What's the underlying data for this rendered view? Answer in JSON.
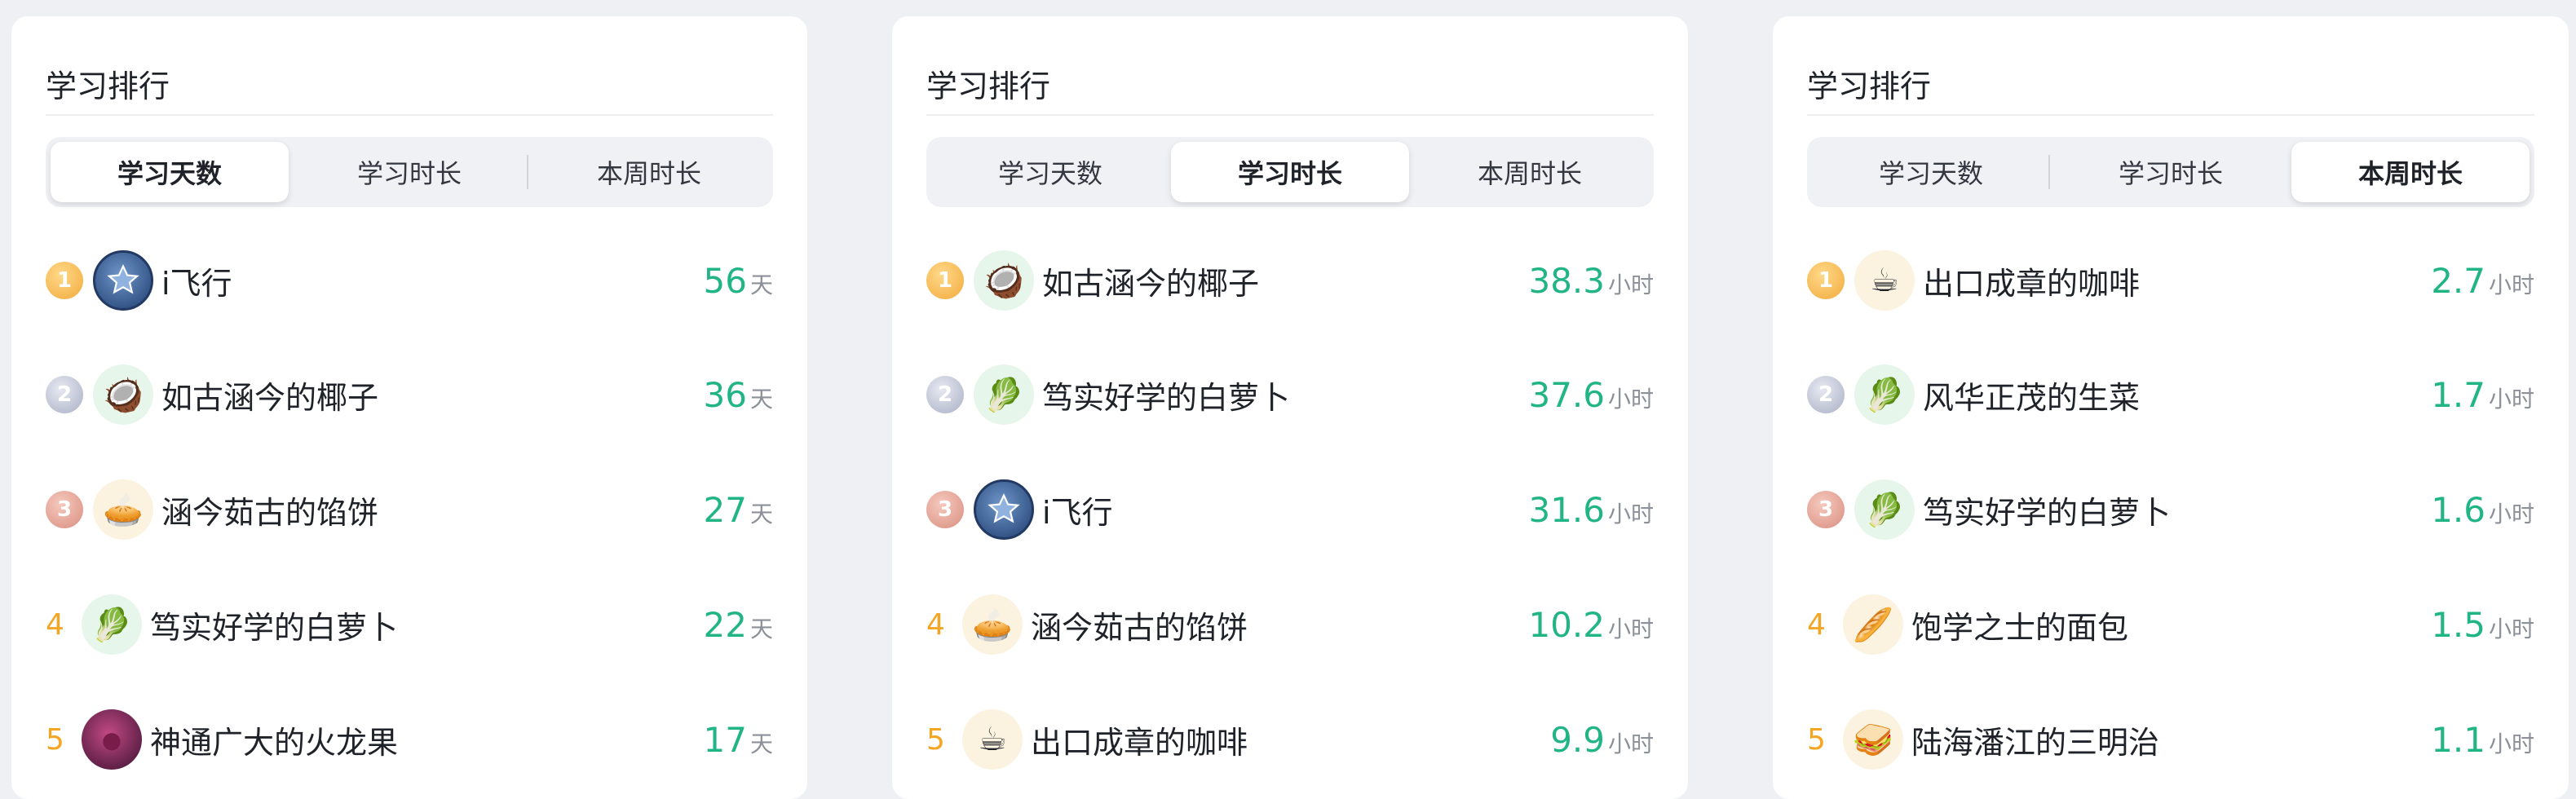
{
  "panels": [
    {
      "title": "学习排行",
      "tabs": [
        "学习天数",
        "学习时长",
        "本周时长"
      ],
      "active_tab": 0,
      "unit": "天",
      "rows": [
        {
          "rank": "1",
          "medal": "gold",
          "name": "i飞行",
          "value": "56",
          "avatar": "star",
          "avatar_style": "blue"
        },
        {
          "rank": "2",
          "medal": "silver",
          "name": "如古涵今的椰子",
          "value": "36",
          "avatar": "🥥",
          "avatar_style": "green"
        },
        {
          "rank": "3",
          "medal": "bronze",
          "name": "涵今茹古的馅饼",
          "value": "27",
          "avatar": "🥧",
          "avatar_style": "cream"
        },
        {
          "rank": "4",
          "medal": "",
          "name": "笃实好学的白萝卜",
          "value": "22",
          "avatar": "🥬",
          "avatar_style": "green"
        },
        {
          "rank": "5",
          "medal": "",
          "name": "神通广大的火龙果",
          "value": "17",
          "avatar": "●",
          "avatar_style": "purple"
        }
      ]
    },
    {
      "title": "学习排行",
      "tabs": [
        "学习天数",
        "学习时长",
        "本周时长"
      ],
      "active_tab": 1,
      "unit": "小时",
      "rows": [
        {
          "rank": "1",
          "medal": "gold",
          "name": "如古涵今的椰子",
          "value": "38.3",
          "avatar": "🥥",
          "avatar_style": "green"
        },
        {
          "rank": "2",
          "medal": "silver",
          "name": "笃实好学的白萝卜",
          "value": "37.6",
          "avatar": "🥬",
          "avatar_style": "green"
        },
        {
          "rank": "3",
          "medal": "bronze",
          "name": "i飞行",
          "value": "31.6",
          "avatar": "star",
          "avatar_style": "blue"
        },
        {
          "rank": "4",
          "medal": "",
          "name": "涵今茹古的馅饼",
          "value": "10.2",
          "avatar": "🥧",
          "avatar_style": "cream"
        },
        {
          "rank": "5",
          "medal": "",
          "name": "出口成章的咖啡",
          "value": "9.9",
          "avatar": "☕",
          "avatar_style": "cream"
        }
      ]
    },
    {
      "title": "学习排行",
      "tabs": [
        "学习天数",
        "学习时长",
        "本周时长"
      ],
      "active_tab": 2,
      "unit": "小时",
      "rows": [
        {
          "rank": "1",
          "medal": "gold",
          "name": "出口成章的咖啡",
          "value": "2.7",
          "avatar": "☕",
          "avatar_style": "cream"
        },
        {
          "rank": "2",
          "medal": "silver",
          "name": "风华正茂的生菜",
          "value": "1.7",
          "avatar": "🥬",
          "avatar_style": "green"
        },
        {
          "rank": "3",
          "medal": "bronze",
          "name": "笃实好学的白萝卜",
          "value": "1.6",
          "avatar": "🥬",
          "avatar_style": "green"
        },
        {
          "rank": "4",
          "medal": "",
          "name": "饱学之士的面包",
          "value": "1.5",
          "avatar": "🥖",
          "avatar_style": "cream"
        },
        {
          "rank": "5",
          "medal": "",
          "name": "陆海潘江的三明治",
          "value": "1.1",
          "avatar": "🥪",
          "avatar_style": "cream"
        }
      ]
    }
  ],
  "colors": {
    "accent_green": "#21b585",
    "rank_orange": "#f5a524",
    "background": "#eef0f4"
  }
}
